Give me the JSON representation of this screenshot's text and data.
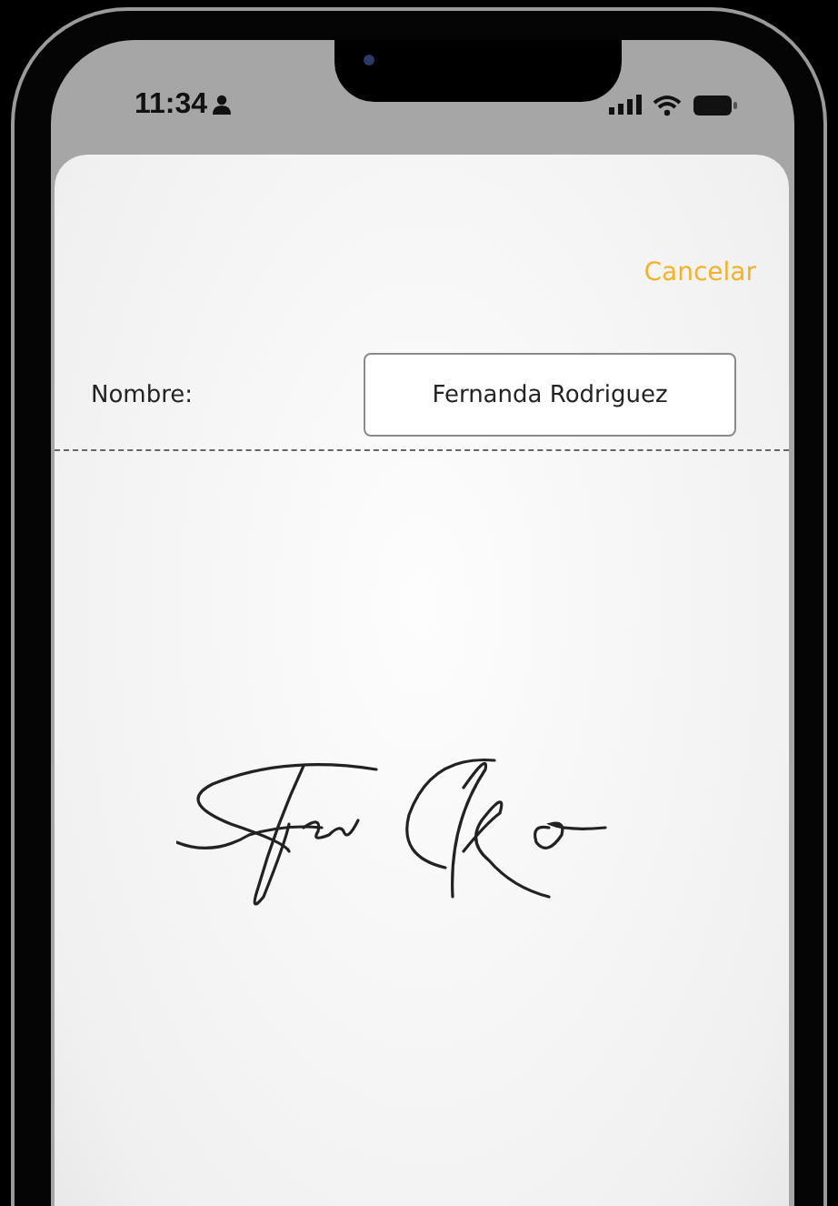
{
  "status_bar": {
    "time": "11:34"
  },
  "form": {
    "cancel": "Cancelar",
    "name_label": "Nombre:",
    "name_value": "Fernanda Rodriguez"
  }
}
